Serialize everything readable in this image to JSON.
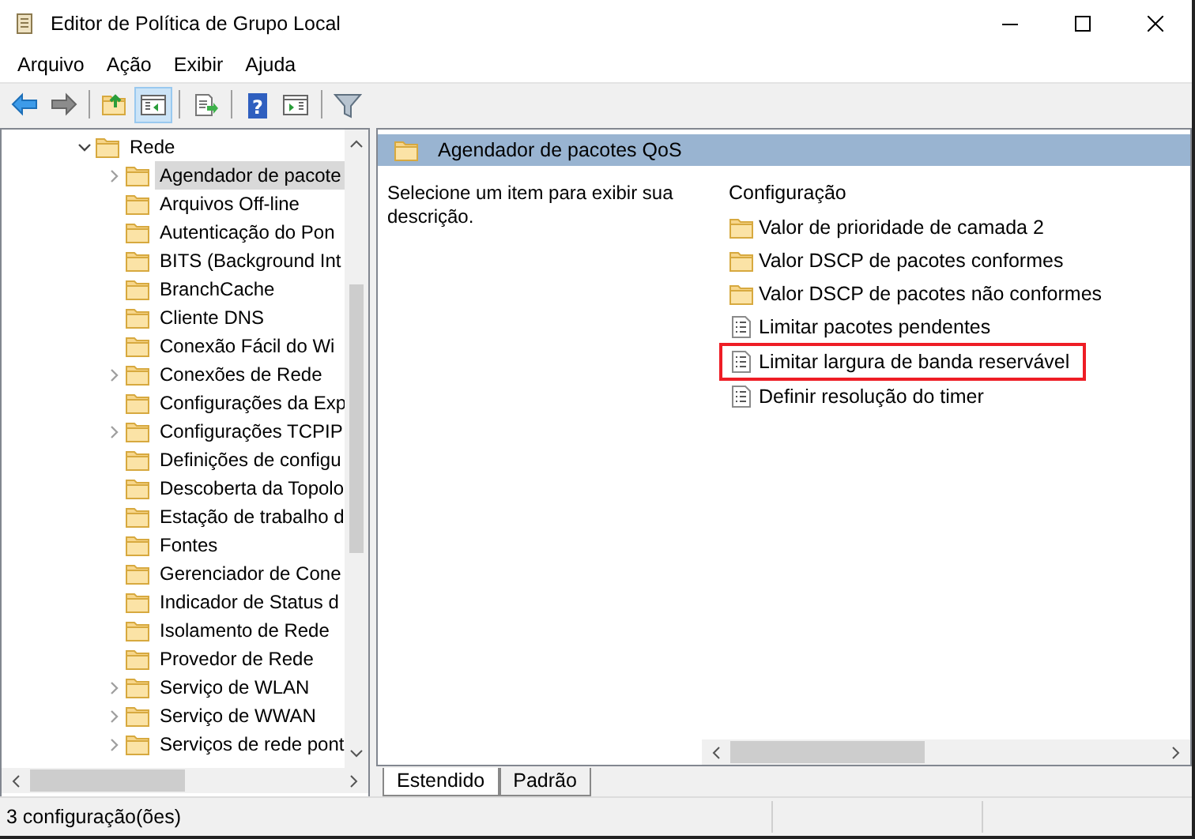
{
  "window": {
    "title": "Editor de Política de Grupo Local"
  },
  "menu": [
    "Arquivo",
    "Ação",
    "Exibir",
    "Ajuda"
  ],
  "toolbar": [
    {
      "kind": "back",
      "pressed": false
    },
    {
      "kind": "forward",
      "pressed": false
    },
    {
      "kind": "sep"
    },
    {
      "kind": "up",
      "pressed": false
    },
    {
      "kind": "pane",
      "pressed": true
    },
    {
      "kind": "sep"
    },
    {
      "kind": "export",
      "pressed": false
    },
    {
      "kind": "sep"
    },
    {
      "kind": "help",
      "pressed": false,
      "glyph": "?"
    },
    {
      "kind": "props",
      "pressed": false
    },
    {
      "kind": "sep"
    },
    {
      "kind": "filter",
      "pressed": false
    }
  ],
  "tree": [
    {
      "label": "Rede",
      "expanded": true,
      "selected": false,
      "children": [
        {
          "label": "Agendador de pacote",
          "has_children": true,
          "selected": true
        },
        {
          "label": "Arquivos Off-line",
          "has_children": false,
          "selected": false
        },
        {
          "label": "Autenticação do Pon",
          "has_children": false,
          "selected": false
        },
        {
          "label": "BITS (Background Int",
          "has_children": false,
          "selected": false
        },
        {
          "label": "BranchCache",
          "has_children": false,
          "selected": false
        },
        {
          "label": "Cliente DNS",
          "has_children": false,
          "selected": false
        },
        {
          "label": "Conexão Fácil do Wi",
          "has_children": false,
          "selected": false
        },
        {
          "label": "Conexões de Rede",
          "has_children": true,
          "selected": false
        },
        {
          "label": "Configurações da Exp",
          "has_children": false,
          "selected": false
        },
        {
          "label": "Configurações TCPIP",
          "has_children": true,
          "selected": false
        },
        {
          "label": "Definições de configu",
          "has_children": false,
          "selected": false
        },
        {
          "label": "Descoberta da Topolo",
          "has_children": false,
          "selected": false
        },
        {
          "label": "Estação de trabalho d",
          "has_children": false,
          "selected": false
        },
        {
          "label": "Fontes",
          "has_children": false,
          "selected": false
        },
        {
          "label": "Gerenciador de Cone",
          "has_children": false,
          "selected": false
        },
        {
          "label": "Indicador de Status d",
          "has_children": false,
          "selected": false
        },
        {
          "label": "Isolamento de Rede",
          "has_children": false,
          "selected": false
        },
        {
          "label": "Provedor de Rede",
          "has_children": false,
          "selected": false
        },
        {
          "label": "Serviço de WLAN",
          "has_children": true,
          "selected": false
        },
        {
          "label": "Serviço de WWAN",
          "has_children": true,
          "selected": false
        },
        {
          "label": "Serviços de rede pont",
          "has_children": true,
          "selected": false
        }
      ]
    }
  ],
  "detail": {
    "header": "Agendador de pacotes QoS",
    "description": "Selecione um item para exibir sua descrição.",
    "column": "Configuração",
    "items": [
      {
        "kind": "folder",
        "label": "Valor de prioridade de camada 2",
        "highlighted": false
      },
      {
        "kind": "folder",
        "label": "Valor DSCP de pacotes conformes",
        "highlighted": false
      },
      {
        "kind": "folder",
        "label": "Valor DSCP de pacotes não conformes",
        "highlighted": false
      },
      {
        "kind": "setting",
        "label": "Limitar pacotes pendentes",
        "highlighted": false
      },
      {
        "kind": "setting",
        "label": "Limitar largura de banda reservável",
        "highlighted": true
      },
      {
        "kind": "setting",
        "label": "Definir resolução do timer",
        "highlighted": false
      }
    ]
  },
  "view_tabs": [
    {
      "label": "Estendido",
      "selected": true
    },
    {
      "label": "Padrão",
      "selected": false
    }
  ],
  "status_bar": "3 configuração(ões)"
}
